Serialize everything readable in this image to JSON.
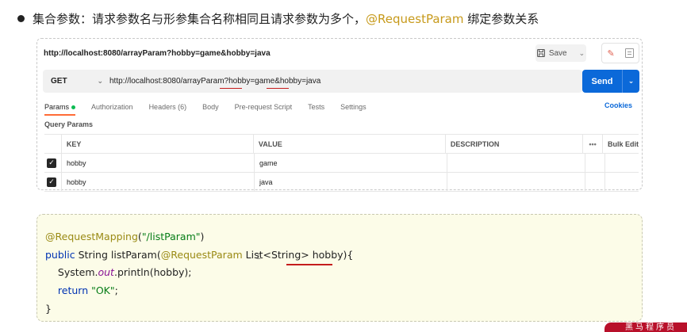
{
  "heading": {
    "prefix": "集合参数：请求参数名与形参集合名称相同且请求参数为多个，",
    "accent": "@RequestParam",
    "suffix": " 绑定参数关系",
    "accent_color": "#c79a1b"
  },
  "postman": {
    "title_url": "http://localhost:8080/arrayParam?hobby=game&hobby=java",
    "save_label": "Save",
    "method": "GET",
    "url_parts": [
      "http://localhost:8080/arrayParam?",
      "hobby",
      "=game&",
      "hobby",
      "=java"
    ],
    "send_label": "Send",
    "send_color": "#0b69d9",
    "tabs": [
      {
        "label": "Params",
        "active": true
      },
      {
        "label": "Authorization"
      },
      {
        "label": "Headers (6)"
      },
      {
        "label": "Body"
      },
      {
        "label": "Pre-request Script"
      },
      {
        "label": "Tests"
      },
      {
        "label": "Settings"
      }
    ],
    "cookies_label": "Cookies",
    "query_params_label": "Query Params",
    "table": {
      "headers": {
        "key": "KEY",
        "value": "VALUE",
        "description": "DESCRIPTION",
        "more": "•••",
        "bulk": "Bulk Edit"
      },
      "rows": [
        {
          "checked": true,
          "key": "hobby",
          "value": "game",
          "description": ""
        },
        {
          "checked": true,
          "key": "hobby",
          "value": "java",
          "description": ""
        }
      ]
    }
  },
  "code": {
    "line1_anno": "@RequestMapping",
    "line1_open": "(",
    "line1_str": "\"/listParam\"",
    "line1_close": ")",
    "line2_kw": "public",
    "line2_type": " String ",
    "line2_method": "listParam",
    "line2_open": "(",
    "line2_anno": "@RequestParam",
    "line2_rest": " List<String> hobby){",
    "line3_a": "    System.",
    "line3_field": "out",
    "line3_b": ".println(hobby);",
    "line4_kw": "    return ",
    "line4_str": "\"OK\"",
    "line4_end": ";",
    "line5": "}"
  },
  "corner_text": "黑马程序员"
}
